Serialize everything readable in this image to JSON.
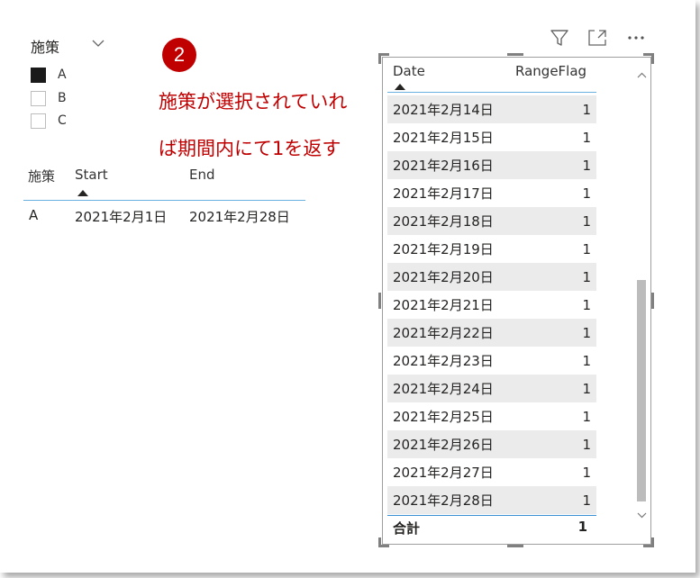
{
  "slicer": {
    "title": "施策",
    "items": [
      {
        "label": "A",
        "checked": true
      },
      {
        "label": "B",
        "checked": false
      },
      {
        "label": "C",
        "checked": false
      }
    ]
  },
  "small_table": {
    "headers": [
      "施策",
      "Start",
      "End"
    ],
    "row": [
      "A",
      "2021年2月1日",
      "2021年2月28日"
    ]
  },
  "annotation": {
    "badge": "2",
    "line1": "施策が選択されていれ",
    "line2": "ば期間内にて1を返す",
    "color": "#c00000"
  },
  "toolbar": {
    "icons": [
      "filter-icon",
      "focus-mode-icon",
      "more-options-icon"
    ]
  },
  "main_table": {
    "headers": [
      "Date",
      "RangeFlag"
    ],
    "rows": [
      {
        "date": "2021年2月14日",
        "flag": "1"
      },
      {
        "date": "2021年2月15日",
        "flag": "1"
      },
      {
        "date": "2021年2月16日",
        "flag": "1"
      },
      {
        "date": "2021年2月17日",
        "flag": "1"
      },
      {
        "date": "2021年2月18日",
        "flag": "1"
      },
      {
        "date": "2021年2月19日",
        "flag": "1"
      },
      {
        "date": "2021年2月20日",
        "flag": "1"
      },
      {
        "date": "2021年2月21日",
        "flag": "1"
      },
      {
        "date": "2021年2月22日",
        "flag": "1"
      },
      {
        "date": "2021年2月23日",
        "flag": "1"
      },
      {
        "date": "2021年2月24日",
        "flag": "1"
      },
      {
        "date": "2021年2月25日",
        "flag": "1"
      },
      {
        "date": "2021年2月26日",
        "flag": "1"
      },
      {
        "date": "2021年2月27日",
        "flag": "1"
      },
      {
        "date": "2021年2月28日",
        "flag": "1"
      }
    ],
    "total_label": "合計",
    "total_value": "1"
  },
  "colors": {
    "header_line": "#6bb1df",
    "total_line": "#3b8fd3",
    "row_shade": "#ebebeb"
  }
}
